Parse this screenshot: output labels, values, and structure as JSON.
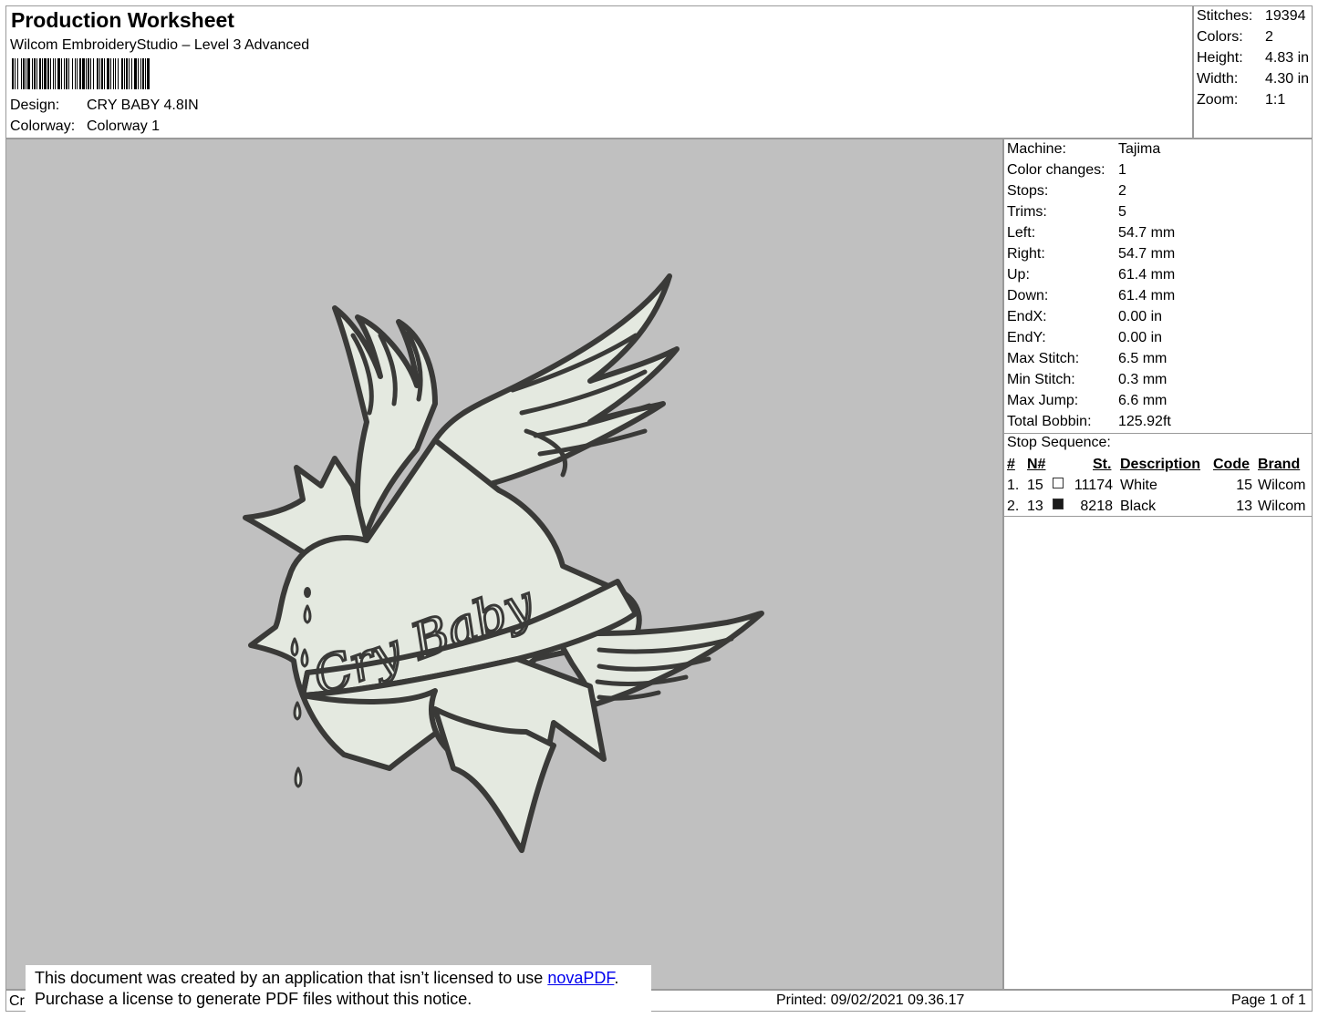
{
  "header": {
    "title": "Production Worksheet",
    "software": "Wilcom EmbroideryStudio – Level 3 Advanced",
    "design_label": "Design:",
    "design_value": "CRY BABY 4.8IN",
    "colorway_label": "Colorway:",
    "colorway_value": "Colorway 1"
  },
  "summary": {
    "stitches_label": "Stitches:",
    "stitches_value": "19394",
    "colors_label": "Colors:",
    "colors_value": "2",
    "height_label": "Height:",
    "height_value": "4.83 in",
    "width_label": "Width:",
    "width_value": "4.30 in",
    "zoom_label": "Zoom:",
    "zoom_value": "1:1"
  },
  "machine_info": [
    {
      "label": "Machine:",
      "value": "Tajima"
    },
    {
      "label": "Color changes:",
      "value": "1"
    },
    {
      "label": "Stops:",
      "value": "2"
    },
    {
      "label": "Trims:",
      "value": "5"
    },
    {
      "label": "Left:",
      "value": "54.7 mm"
    },
    {
      "label": "Right:",
      "value": "54.7 mm"
    },
    {
      "label": "Up:",
      "value": "61.4 mm"
    },
    {
      "label": "Down:",
      "value": "61.4 mm"
    },
    {
      "label": "EndX:",
      "value": "0.00 in"
    },
    {
      "label": "EndY:",
      "value": "0.00 in"
    },
    {
      "label": "Max Stitch:",
      "value": "6.5 mm"
    },
    {
      "label": "Min Stitch:",
      "value": "0.3 mm"
    },
    {
      "label": "Max Jump:",
      "value": "6.6 mm"
    },
    {
      "label": "Total Bobbin:",
      "value": "125.92ft"
    }
  ],
  "stop_sequence": {
    "title": "Stop Sequence:",
    "columns": {
      "num": "#",
      "n": "N#",
      "st": "St.",
      "description": "Description",
      "code": "Code",
      "brand": "Brand"
    },
    "rows": [
      {
        "num": "1.",
        "n": "15",
        "color": "#ffffff",
        "st": "11174",
        "description": "White",
        "code": "15",
        "brand": "Wilcom"
      },
      {
        "num": "2.",
        "n": "13",
        "color": "#1a1a1a",
        "st": "8218",
        "description": "Black",
        "code": "13",
        "brand": "Wilcom"
      }
    ]
  },
  "design": {
    "fill_color": "#e4e9e0",
    "outline_color": "#3a3a38",
    "background_color": "#c0c0c0",
    "banner_text": "Cry Baby"
  },
  "footer": {
    "cut_text": "Cr",
    "printed": "Printed: 09/02/2021 09.36.17",
    "page": "Page 1 of 1"
  },
  "notice": {
    "line1_prefix": "This document was created by an application that isn’t licensed to use ",
    "link_text": "novaPDF",
    "line1_suffix": ".",
    "line2": "Purchase a license to generate PDF files without this notice."
  }
}
